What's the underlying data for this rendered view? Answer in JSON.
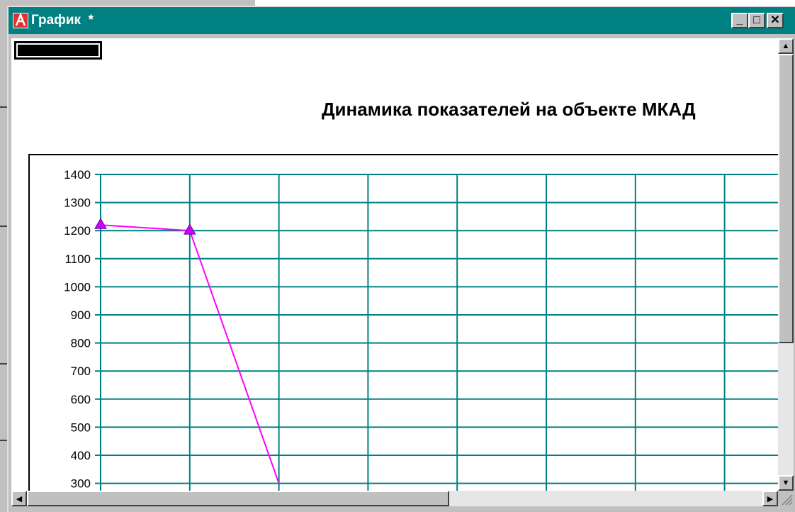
{
  "window": {
    "title": "График  *",
    "buttons": {
      "minimize": "_",
      "maximize": "□",
      "close": "✕"
    }
  },
  "chart_data": {
    "type": "line",
    "title": "Динамика показателей на объекте МКАД",
    "xlabel": "",
    "ylabel": "",
    "ylim": [
      300,
      1400
    ],
    "y_ticks": [
      1400,
      1300,
      1200,
      1100,
      1000,
      900,
      800,
      700,
      600,
      500,
      400,
      300
    ],
    "grid": true,
    "x": [
      0,
      1,
      2
    ],
    "series": [
      {
        "values": [
          1220,
          1200,
          300
        ],
        "color": "#ff00ff"
      }
    ]
  },
  "colors": {
    "titlebar": "#008080",
    "grid": "#008080",
    "series": "#ff00ff"
  },
  "icons": {
    "app": "graph-app-icon",
    "scroll_up": "arrow-up-icon",
    "scroll_down": "arrow-down-icon",
    "scroll_left": "arrow-left-icon",
    "scroll_right": "arrow-right-icon"
  }
}
